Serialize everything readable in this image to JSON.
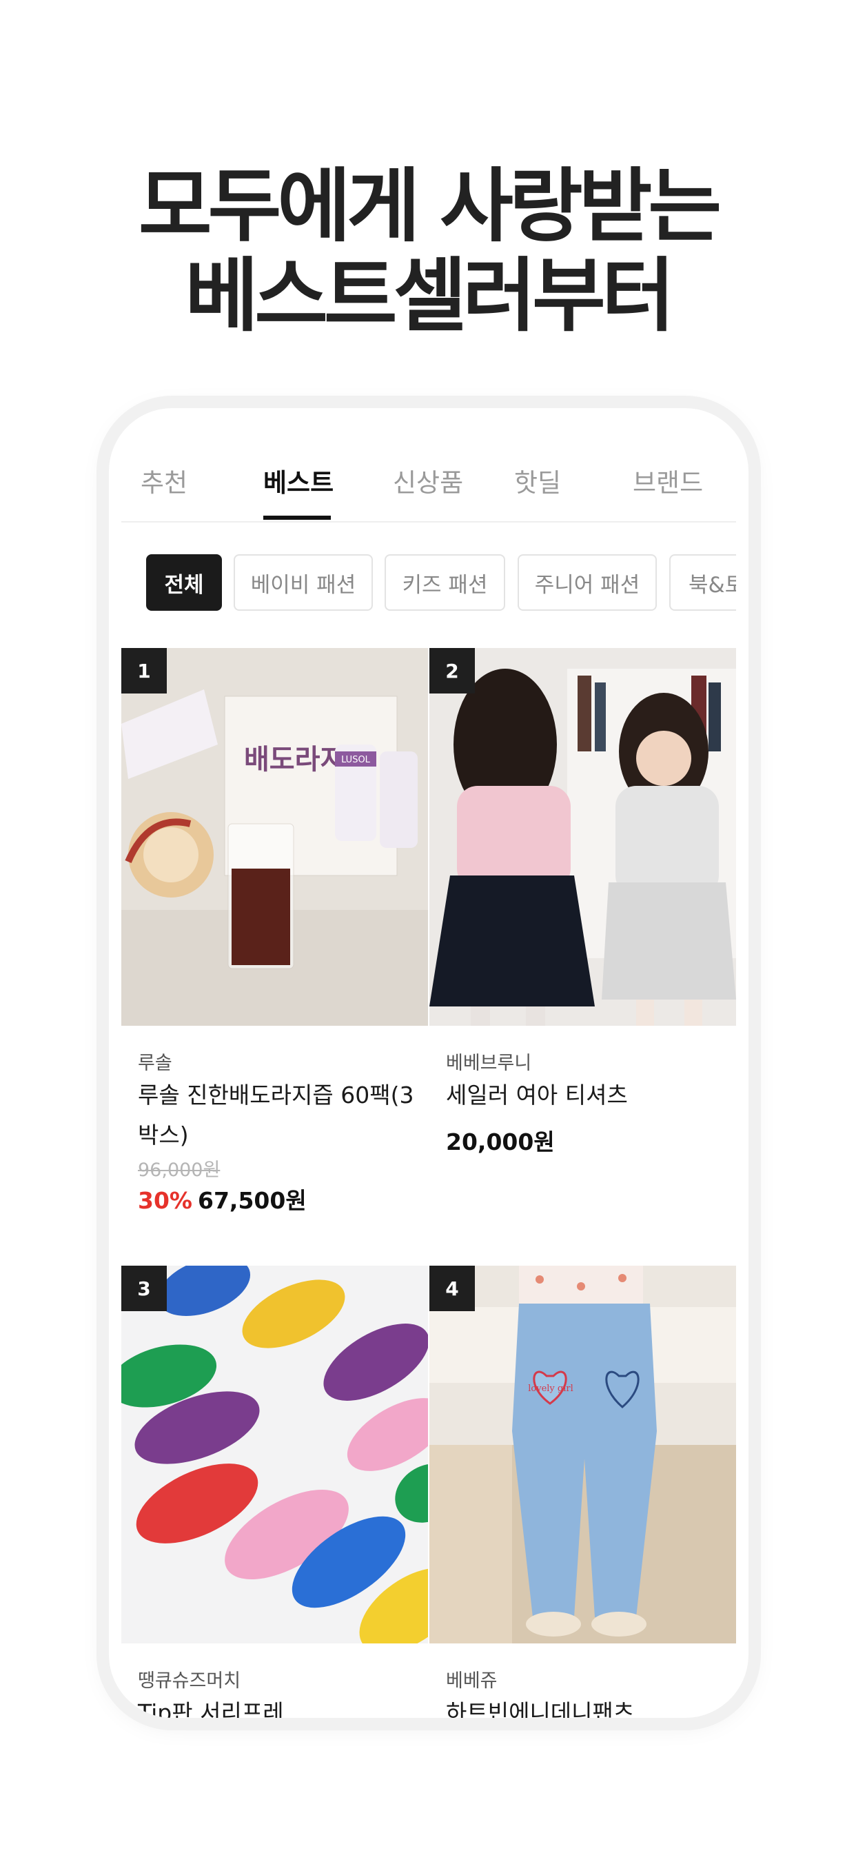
{
  "headline": {
    "line1": "모두에게 사랑받는",
    "line2": "베스트셀러부터"
  },
  "tabs": [
    {
      "label": "추천"
    },
    {
      "label": "베스트"
    },
    {
      "label": "신상품"
    },
    {
      "label": "핫딜"
    },
    {
      "label": "브랜드"
    }
  ],
  "active_tab": "베스트",
  "chips": [
    {
      "label": "전체"
    },
    {
      "label": "베이비 패션"
    },
    {
      "label": "키즈 패션"
    },
    {
      "label": "주니어 패션"
    },
    {
      "label": "북&토"
    }
  ],
  "products": [
    {
      "rank": "1",
      "brand": "루솔",
      "name": "루솔 진한배도라지즙 60팩(3박스)",
      "original_price": "96,000원",
      "discount": "30%",
      "price": "67,500원",
      "image_package_text": "배도라지즙",
      "image_pouch_text": "LUSOL"
    },
    {
      "rank": "2",
      "brand": "베베브루니",
      "name": "세일러 여아 티셔츠",
      "price": "20,000원"
    },
    {
      "rank": "3",
      "brand": "땡큐슈즈머치",
      "name": "Tip판 서리프레"
    },
    {
      "rank": "4",
      "brand": "베베쥬",
      "name": "하트빈에니데니팬츠",
      "image_patch_text": "lovely girl"
    }
  ],
  "colors": {
    "discount": "#e6322b",
    "tab_active": "#111111",
    "chip_active_bg": "#1b1b1b"
  }
}
